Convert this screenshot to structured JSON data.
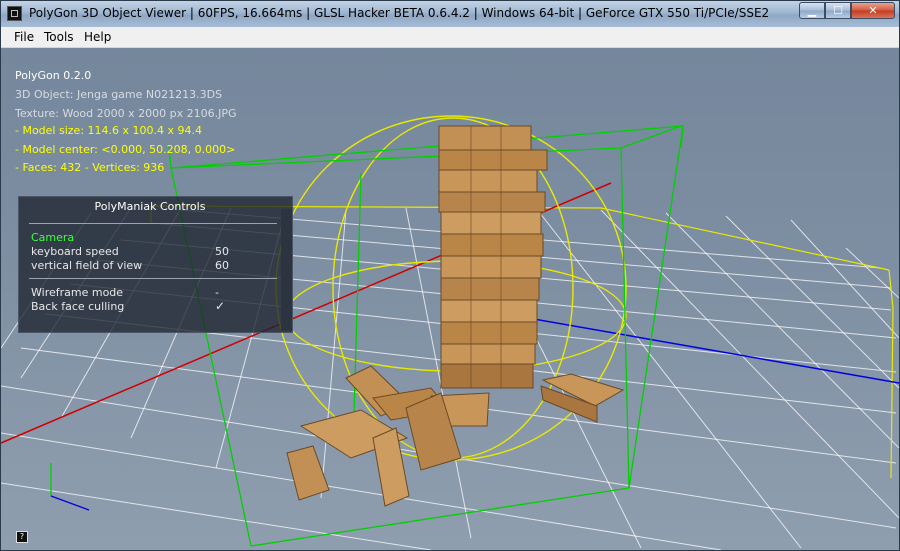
{
  "window": {
    "title": "PolyGon 3D Object Viewer | 60FPS, 16.664ms | GLSL Hacker BETA 0.6.4.2 | Windows 64-bit | GeForce GTX 550 Ti/PCIe/SSE2",
    "minimize_icon": "minimize-icon",
    "maximize_icon": "maximize-icon",
    "close_icon": "close-icon"
  },
  "menu": {
    "file": "File",
    "tools": "Tools",
    "help": "Help"
  },
  "info": {
    "app": "PolyGon 0.2.0",
    "object": "3D Object: Jenga game N021213.3DS",
    "texture": "Texture: Wood 2000 x 2000 px 2106.JPG",
    "model_size": "- Model size:  114.6 x 100.4 x 94.4",
    "model_center": "- Model center:  <0.000, 50.208, 0.000>",
    "faces": "- Faces: 432 - Vertices: 936"
  },
  "controls": {
    "title": "PolyManiak Controls",
    "section_camera": "Camera",
    "keyboard_speed_label": "keyboard speed",
    "keyboard_speed_value": "50",
    "fov_label": "vertical field of view",
    "fov_value": "60",
    "wireframe_label": "Wireframe mode",
    "wireframe_value": "-",
    "backface_label": "Back face culling",
    "backface_value": "✓"
  },
  "colors": {
    "info_white": "#ffffff",
    "info_yellow": "#ffff00",
    "section_green": "#40ff40",
    "bbox_green": "#00d000",
    "sphere_yellow": "#e8e800",
    "axis_red": "#d00000",
    "axis_blue": "#0000e0",
    "wood": "#c9965a"
  },
  "icons": {
    "help": "help-icon"
  }
}
